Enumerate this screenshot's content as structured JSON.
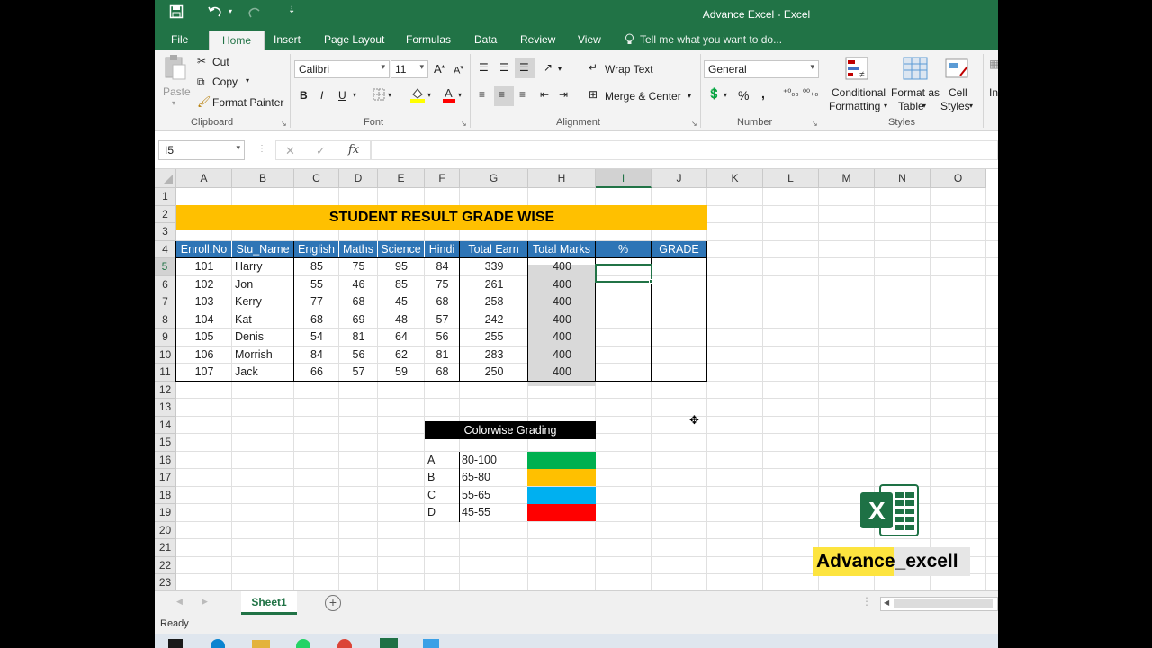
{
  "window": {
    "title": "Advance Excel - Excel"
  },
  "ribbon_tabs": [
    "File",
    "Home",
    "Insert",
    "Page Layout",
    "Formulas",
    "Data",
    "Review",
    "View"
  ],
  "tell_me": "Tell me what you want to do...",
  "clipboard": {
    "paste": "Paste",
    "cut": "Cut",
    "copy": "Copy",
    "format_painter": "Format Painter",
    "group": "Clipboard"
  },
  "font": {
    "name": "Calibri",
    "size": "11",
    "bold": "B",
    "italic": "I",
    "underline": "U",
    "group": "Font"
  },
  "alignment": {
    "wrap": "Wrap Text",
    "merge": "Merge & Center",
    "group": "Alignment"
  },
  "number": {
    "format": "General",
    "percent": "%",
    "comma": ",",
    "group": "Number"
  },
  "styles": {
    "cond1": "Conditional",
    "cond2": "Formatting",
    "fmt1": "Format as",
    "fmt2": "Table",
    "cell1": "Cell",
    "cell2": "Styles",
    "group": "Styles",
    "insert": "In"
  },
  "name_box": "I5",
  "formula_icons": {
    "cancel": "✕",
    "enter": "✓",
    "fx": "fx"
  },
  "columns": [
    "A",
    "B",
    "C",
    "D",
    "E",
    "F",
    "G",
    "H",
    "I",
    "J",
    "K",
    "L",
    "M",
    "N",
    "O"
  ],
  "rows": [
    "1",
    "2",
    "3",
    "4",
    "5",
    "6",
    "7",
    "8",
    "9",
    "10",
    "11",
    "12",
    "13",
    "14",
    "15",
    "16",
    "17",
    "18",
    "19",
    "20",
    "21",
    "22",
    "23"
  ],
  "sheet_title": "STUDENT RESULT GRADE WISE",
  "table_headers": [
    "Enroll.No",
    "Stu_Name",
    "English",
    "Maths",
    "Science",
    "Hindi",
    "Total Earn",
    "Total Marks",
    "%",
    "GRADE"
  ],
  "students": [
    {
      "enroll": "101",
      "name": "Harry",
      "english": "85",
      "maths": "75",
      "science": "95",
      "hindi": "84",
      "earn": "339",
      "total": "400"
    },
    {
      "enroll": "102",
      "name": "Jon",
      "english": "55",
      "maths": "46",
      "science": "85",
      "hindi": "75",
      "earn": "261",
      "total": "400"
    },
    {
      "enroll": "103",
      "name": "Kerry",
      "english": "77",
      "maths": "68",
      "science": "45",
      "hindi": "68",
      "earn": "258",
      "total": "400"
    },
    {
      "enroll": "104",
      "name": "Kat",
      "english": "68",
      "maths": "69",
      "science": "48",
      "hindi": "57",
      "earn": "242",
      "total": "400"
    },
    {
      "enroll": "105",
      "name": "Denis",
      "english": "54",
      "maths": "81",
      "science": "64",
      "hindi": "56",
      "earn": "255",
      "total": "400"
    },
    {
      "enroll": "106",
      "name": "Morrish",
      "english": "84",
      "maths": "56",
      "science": "62",
      "hindi": "81",
      "earn": "283",
      "total": "400"
    },
    {
      "enroll": "107",
      "name": "Jack",
      "english": "66",
      "maths": "57",
      "science": "59",
      "hindi": "68",
      "earn": "250",
      "total": "400"
    }
  ],
  "grading": {
    "title": "Colorwise Grading",
    "items": [
      {
        "grade": "A",
        "range": "80-100",
        "color": "#00b050"
      },
      {
        "grade": "B",
        "range": "65-80",
        "color": "#ffc000"
      },
      {
        "grade": "C",
        "range": "55-65",
        "color": "#00b0f0"
      },
      {
        "grade": "D",
        "range": "45-55",
        "color": "#ff0000"
      }
    ]
  },
  "colors": {
    "banner": "#ffc000",
    "header": "#2e75b6",
    "total_marks_fill": "#d9d9d9",
    "excel_green": "#217346"
  },
  "sheet_tab": "Sheet1",
  "add_sheet": "+",
  "status": "Ready",
  "badge": "Advance_excell",
  "excel_logo_letter": "X"
}
